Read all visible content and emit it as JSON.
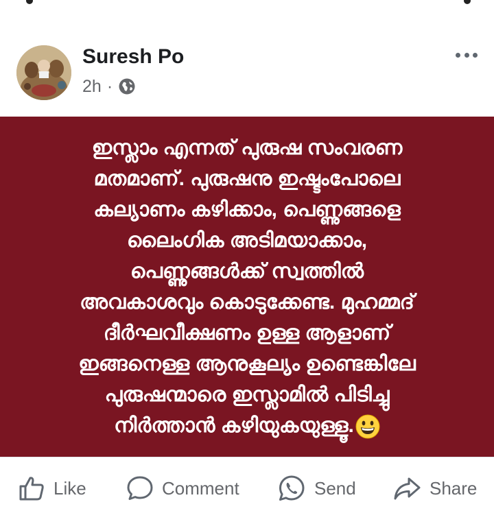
{
  "post": {
    "author": "Suresh Po",
    "time": "2h",
    "separator": "·",
    "lines": [
      "ഇസ്ലാം എന്നത് പുരുഷ സംവരണ",
      "മതമാണ്. പുരുഷനു ഇഷ്ടംപോലെ",
      "കല്യാണം കഴിക്കാം, പെണ്ണുങ്ങളെ",
      "ലൈംഗിക അടിമയാക്കാം,",
      "പെണ്ണുങ്ങൾക്ക് സ്വത്തിൽ",
      "അവകാശവും കൊടുക്കേണ്ട. മുഹമ്മദ്",
      "ദീർഘവീക്ഷണം ഉള്ള ആളാണ്",
      "ഇങ്ങനെള്ള ആനുകൂല്യം ഉണ്ടെങ്കിലേ",
      "പുരുഷന്മാരെ ഇസ്ലാമിൽ പിടിച്ചു",
      "നിർത്താൻ കഴിയുകയുള്ളൂ."
    ],
    "background_color": "#7a1522"
  },
  "actions": {
    "like": "Like",
    "comment": "Comment",
    "send": "Send",
    "share": "Share"
  },
  "icons": {
    "audience": "globe-icon",
    "menu": "more-dots-icon",
    "emoji": "grinning-face-emoji"
  }
}
